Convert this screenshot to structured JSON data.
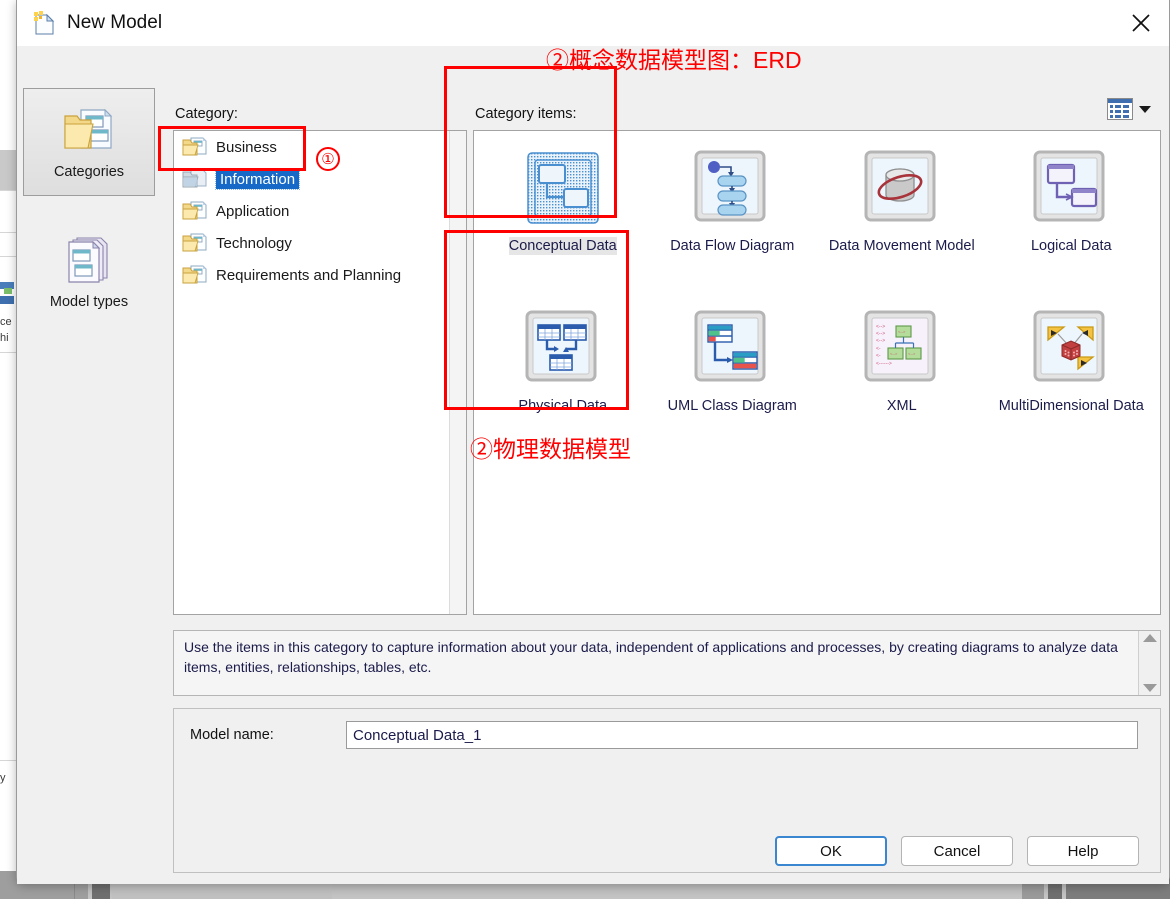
{
  "window": {
    "title": "New Model",
    "title_icon": "new-document-icon",
    "close_icon": "close-icon"
  },
  "labels": {
    "category": "Category:",
    "category_items": "Category items:",
    "model_name": "Model name:"
  },
  "left_rail": [
    {
      "label": "Categories",
      "icon": "categories-icon",
      "selected": true
    },
    {
      "label": "Model types",
      "icon": "model-types-icon",
      "selected": false
    }
  ],
  "categories": [
    {
      "label": "Business",
      "icon": "folder-icon",
      "selected": false
    },
    {
      "label": "Information",
      "icon": "folder-information-icon",
      "selected": true
    },
    {
      "label": "Application",
      "icon": "folder-icon",
      "selected": false
    },
    {
      "label": "Technology",
      "icon": "folder-icon",
      "selected": false
    },
    {
      "label": "Requirements and Planning",
      "icon": "folder-icon",
      "selected": false
    }
  ],
  "category_items": [
    {
      "label": "Conceptual Data",
      "icon": "conceptual-data-icon",
      "selected": true
    },
    {
      "label": "Data Flow Diagram",
      "icon": "data-flow-diagram-icon",
      "selected": false
    },
    {
      "label": "Data Movement Model",
      "icon": "data-movement-model-icon",
      "selected": false
    },
    {
      "label": "Logical Data",
      "icon": "logical-data-icon",
      "selected": false
    },
    {
      "label": "Physical Data",
      "icon": "physical-data-icon",
      "selected": false
    },
    {
      "label": "UML Class Diagram",
      "icon": "uml-class-diagram-icon",
      "selected": false
    },
    {
      "label": "XML",
      "icon": "xml-icon",
      "selected": false
    },
    {
      "label": "MultiDimensional Data",
      "icon": "multidimensional-data-icon",
      "selected": false
    }
  ],
  "description": "Use the items in this category to capture information about your data, independent of applications and processes, by creating diagrams to analyze data items, entities, relationships, tables, etc.",
  "model_name_value": "Conceptual Data_1",
  "buttons": {
    "ok": "OK",
    "cancel": "Cancel",
    "help": "Help"
  },
  "view_toggle": {
    "icon": "list-view-icon",
    "caret": "chevron-down-icon"
  },
  "annotations": {
    "marker_one": "①",
    "top_note": "②概念数据模型图：ERD",
    "bottom_note": "②物理数据模型",
    "color": "#ff0000"
  },
  "background_text": {
    "fragment_1": "ce",
    "fragment_2": "hi",
    "fragment_3": "y"
  }
}
